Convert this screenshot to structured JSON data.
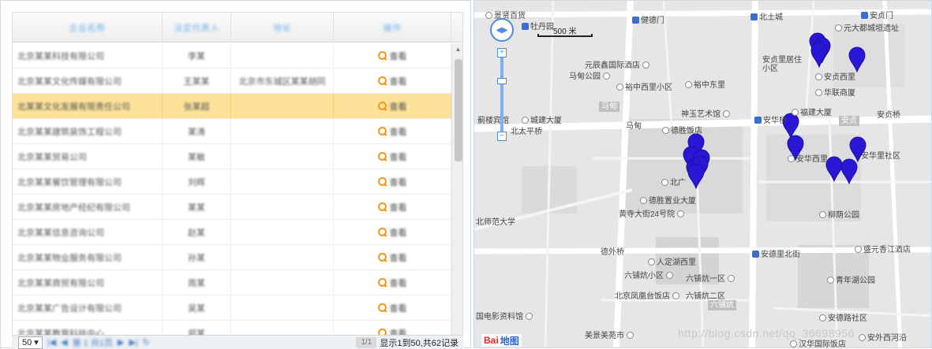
{
  "colors": {
    "accent": "#3a6fd1",
    "selected_row": "#fde39a",
    "marker": "#2a17d6",
    "search_icon": "#f39a1e"
  },
  "grid": {
    "headers": [
      "企业名称",
      "法定代表人",
      "地址",
      "操作"
    ],
    "rows": [
      {
        "name": "北京某某科技有限公司",
        "rep": "李某",
        "addr": "",
        "op": "查看",
        "selected": false
      },
      {
        "name": "北京某某文化传媒有限公司",
        "rep": "王某某",
        "addr": "北京市东城区某某胡同",
        "op": "查看",
        "selected": false
      },
      {
        "name": "北某某文化发展有限责任公司",
        "rep": "张某超",
        "addr": "",
        "op": "查看",
        "selected": true
      },
      {
        "name": "北京某某建筑装饰工程公司",
        "rep": "某涛",
        "addr": "",
        "op": "查看",
        "selected": false
      },
      {
        "name": "北京某某贸易公司",
        "rep": "某敏",
        "addr": "",
        "op": "查看",
        "selected": false
      },
      {
        "name": "北京某某餐饮管理有限公司",
        "rep": "刘辉",
        "addr": "",
        "op": "查看",
        "selected": false
      },
      {
        "name": "北京某某房地产经纪有限公司",
        "rep": "某某",
        "addr": "",
        "op": "查看",
        "selected": false
      },
      {
        "name": "北京某某信息咨询公司",
        "rep": "赵某",
        "addr": "",
        "op": "查看",
        "selected": false
      },
      {
        "name": "北京某某物业服务有限公司",
        "rep": "孙某",
        "addr": "",
        "op": "查看",
        "selected": false
      },
      {
        "name": "北京某某商贸有限公司",
        "rep": "周某",
        "addr": "",
        "op": "查看",
        "selected": false
      },
      {
        "name": "北京某某广告设计有限公司",
        "rep": "吴某",
        "addr": "",
        "op": "查看",
        "selected": false
      },
      {
        "name": "北京某某教育科技中心",
        "rep": "郑某",
        "addr": "",
        "op": "查看",
        "selected": false
      }
    ],
    "scroll_position": 0.05
  },
  "pager": {
    "page_size": "50",
    "page_input": "1",
    "nav_text": "第 1 共1页",
    "btn_label": "1/1",
    "count_text": "显示1到50,共62记录"
  },
  "map": {
    "scale_label": "500 米",
    "zoom_level": 0.3,
    "logo_bai": "Bai",
    "logo_du": "地图",
    "watermark": "http://blog.csdn.net/qq_36698956",
    "labels": {
      "l1": "景贤百货",
      "l2": "牡丹园",
      "l3": "健德门",
      "l4": "北土城",
      "l5": "安贞门",
      "l6": "元大都城垣遗址",
      "l7": "元辰鑫国际酒店",
      "l8": "马甸公园",
      "l9": "安贞里居住小区",
      "l10": "安贞西里",
      "l11": "华联商厦",
      "l12": "裕中西里小区",
      "l13": "裕中东里",
      "l14": "神玉艺术馆",
      "l15": "福建大厦",
      "l16": "安华桥",
      "l17": "安贞桥",
      "l18": "蓟楼宾馆",
      "l19": "城建大厦",
      "l20": "北太平桥",
      "l21": "马甸",
      "l22": "德胜饭店",
      "l23": "北广",
      "l24": "德胜置业大厦",
      "l25": "黄寺大街24号院",
      "l26": "安华西里",
      "l27": "安华里社区",
      "l28": "北师范大学",
      "l29": "柳荫公园",
      "l30": "德外桥",
      "l31": "安德里北街",
      "l32": "盛元香江酒店",
      "l33": "人定湖西里",
      "l34": "六铺炕小区",
      "l35": "六铺炕一区",
      "l36": "青年湖公园",
      "l37": "北京凤凰台饭店",
      "l38": "六铺炕二区",
      "l39": "六铺炕",
      "l40": "国电影资料馆",
      "l41": "安德路社区",
      "l42": "美景美苑市",
      "l43": "汉华国际饭店",
      "l44": "安外西河沿"
    },
    "road_tags": {
      "r1": "马甸",
      "r2": "安贞"
    }
  }
}
